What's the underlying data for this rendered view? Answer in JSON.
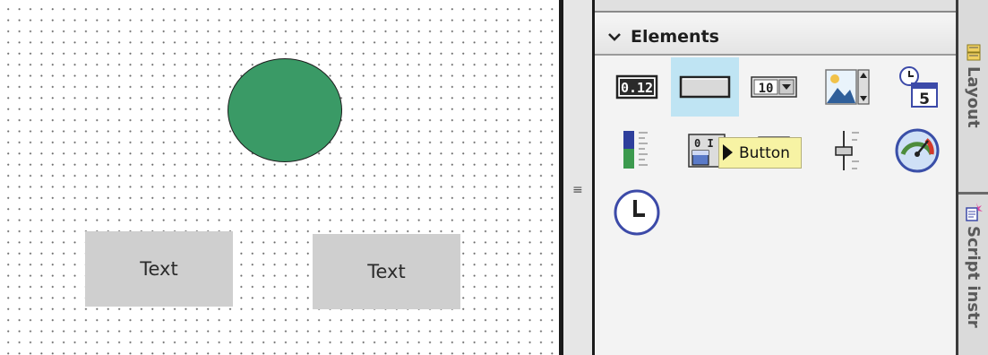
{
  "canvas": {
    "shapes": [
      {
        "type": "ellipse",
        "fill": "#3a9a66"
      }
    ],
    "text_buttons": [
      {
        "label": "Text"
      },
      {
        "label": "Text"
      }
    ]
  },
  "splitter": {
    "grip_glyph": "≡"
  },
  "panel": {
    "title": "Elements",
    "tiles": [
      {
        "name": "io-field",
        "icon": "numeric-display-icon",
        "glyph": "0.12"
      },
      {
        "name": "button",
        "icon": "button-icon",
        "selected": true
      },
      {
        "name": "symbolic-io-field",
        "icon": "symbolic-io-field-icon",
        "glyph": "10"
      },
      {
        "name": "graphic-io-field",
        "icon": "graphic-io-field-icon"
      },
      {
        "name": "date-time-field",
        "icon": "date-time-field-icon",
        "glyph": "5"
      },
      {
        "name": "bar",
        "icon": "bar-graph-icon"
      },
      {
        "name": "switch",
        "icon": "switch-icon",
        "glyph": "0 I"
      },
      {
        "name": "symbol-library",
        "icon": "symbol-library-icon"
      },
      {
        "name": "slider",
        "icon": "slider-icon"
      },
      {
        "name": "gauge",
        "icon": "gauge-icon"
      },
      {
        "name": "clock",
        "icon": "clock-icon"
      }
    ],
    "tooltip": "Button"
  },
  "side_tabs": [
    {
      "label": "Layout",
      "icon": "layout-icon"
    },
    {
      "label": "Script instr",
      "icon": "script-instructions-icon"
    }
  ]
}
